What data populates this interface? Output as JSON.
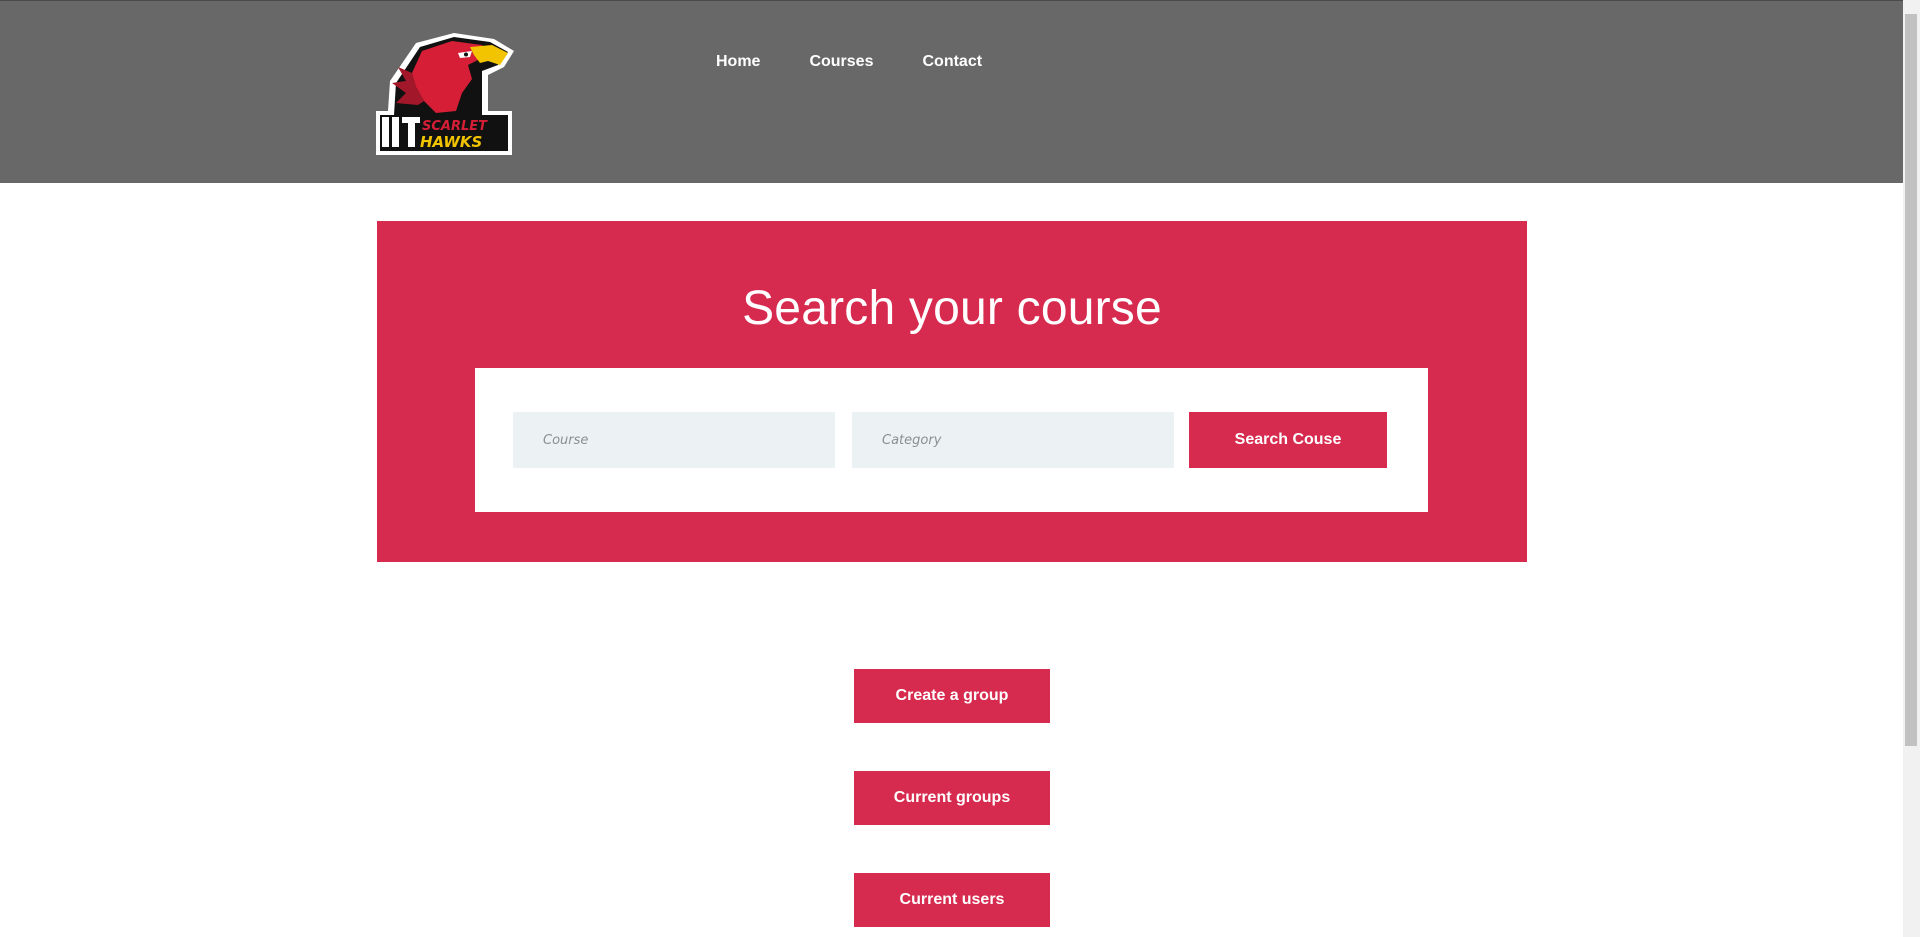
{
  "header": {
    "logo": {
      "text_line1": "IIT",
      "text_line2": "SCARLET",
      "text_line3": "HAWKS"
    },
    "nav": [
      {
        "label": "Home"
      },
      {
        "label": "Courses"
      },
      {
        "label": "Contact"
      }
    ]
  },
  "hero": {
    "title": "Search your course",
    "course_placeholder": "Course",
    "category_placeholder": "Category",
    "search_button": "Search Couse"
  },
  "actions": {
    "create_group": "Create a group",
    "current_groups": "Current groups",
    "current_users": "Current users"
  },
  "colors": {
    "header_bg": "#686868",
    "accent": "#d72a4f",
    "input_bg": "#ecf2f4"
  }
}
